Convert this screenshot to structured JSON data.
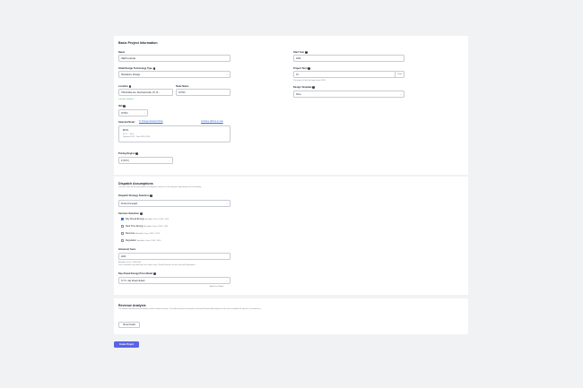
{
  "basic": {
    "title": "Basic Project Information",
    "name_label": "Name",
    "name_value": "VEEH example",
    "tech_label": "Initial Design Technology Type",
    "tech_value": "Standalone Storage",
    "location_label": "Location",
    "location_value": "799 Rubble Ave, Mechanicsville, NY 11...",
    "location_hint": "Location verified ✓",
    "node_label": "Node Name",
    "node_value": "NYISO",
    "iso_label": "ISO",
    "iso_value": "NYISO",
    "selected_nodes_label": "Selected Node:",
    "change_node_link": "N. Change Selected Node",
    "continue_link": "Continue without a node",
    "node_box_title": "N.Y.C.",
    "node_box_line1": "N.Y.C. - Zone",
    "node_box_line2": "Updated 2025 · Data 2018–2024",
    "pricing_label": "Pricing Region",
    "pricing_value": "Z (NYC)",
    "start_label": "Start Year",
    "start_value": "2026",
    "term_label": "Project Term",
    "term_value": "15",
    "term_suffix": "Years",
    "term_hint": "The project's life that begins year 2026",
    "design_label": "Design Template",
    "design_value": "None"
  },
  "dispatch": {
    "title": "Dispatch Assumptions",
    "desc": "The price and market participation assumptions used to set the dispatch optimizations for the battery.",
    "strategy_label": "Dispatch Strategy Selection",
    "strategy_value": "Perfect Foresight",
    "services_label": "Services Selection",
    "services": [
      {
        "label": "Day Ahead Energy",
        "avail": "Available Years: 2018 - 2024",
        "checked": true
      },
      {
        "label": "Real Time Energy",
        "avail": "Available Years: 2018 - 2024",
        "checked": false
      },
      {
        "label": "Reserves",
        "avail": "Available Years: 2018 - 2024",
        "checked": false
      },
      {
        "label": "Regulation",
        "avail": "Available Years: 2018 - 2024",
        "checked": false
      }
    ],
    "hist_label": "Historical Years",
    "hist_value": "2023",
    "hist_hint1": "Available Years: 2018-2024",
    "hist_hint2": "Years available may differ from the node's price. Stored Services for the Day and Regulations",
    "price_label": "Day Ahead Energy Price Model",
    "price_value": "N.Y.C. day ahead default",
    "add_price_link": "Add Price Model"
  },
  "revenue": {
    "title": "Revenue Analysis",
    "desc": "The detailed settlement assumptions used to model revenue. This will post-process based on selected Dispatch Assumptions and can be modified for specific circumstances.",
    "show_details": "Show Details"
  },
  "create_project": "Create Project",
  "icons": {
    "help": "help-icon",
    "chevron": "chevron-down-icon",
    "check": "check-icon"
  },
  "colors": {
    "accent": "#5b63e6",
    "link": "#2f6fd8",
    "success": "#2f9e5b"
  }
}
